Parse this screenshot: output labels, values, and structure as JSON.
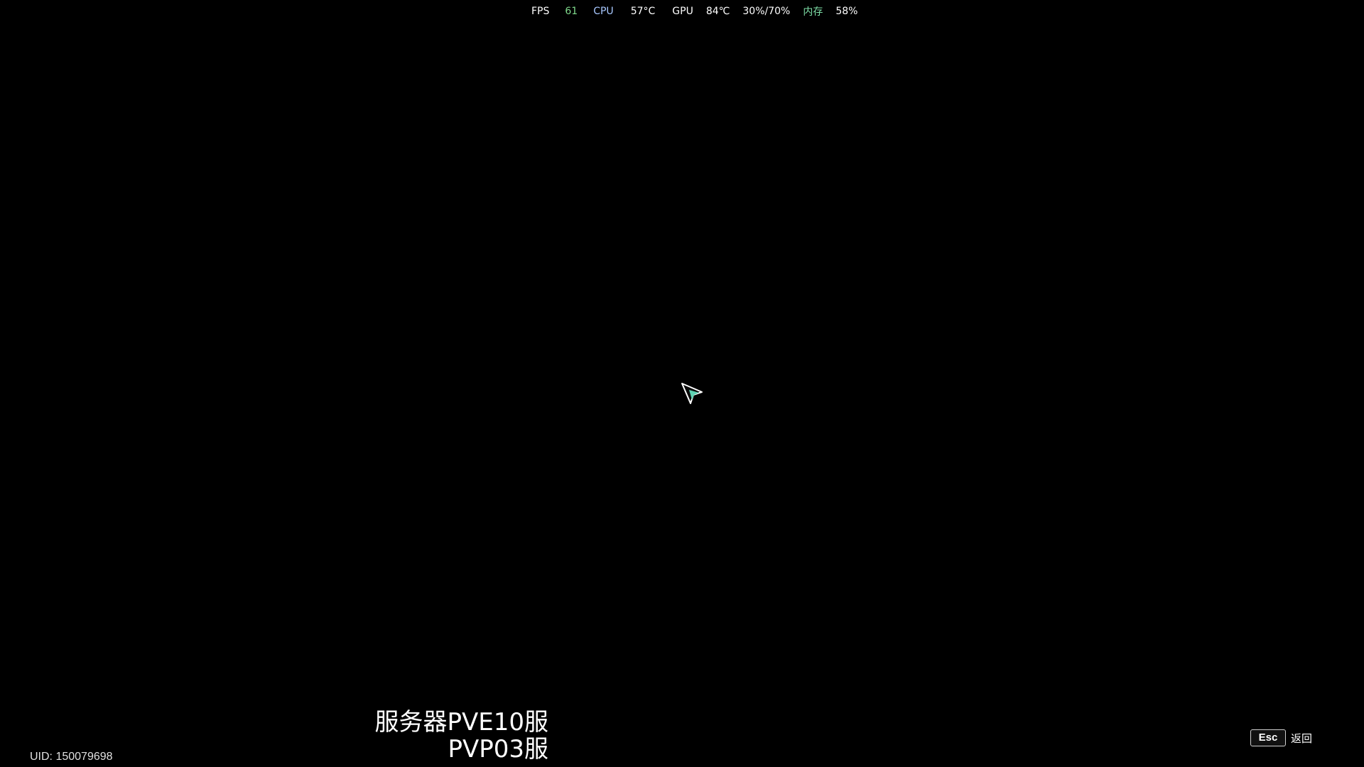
{
  "perf": {
    "fps_label": "FPS",
    "fps_value": "61",
    "cpu_label": "CPU",
    "cpu_temp": "57°C",
    "gpu_label": "GPU",
    "gpu_temp": "84℃",
    "gpu_usage": "30%/70%",
    "mem_label": "内存",
    "mem_value": "58%"
  },
  "server": {
    "line1": "服务器PVE10服",
    "line2": "PVP03服"
  },
  "uid": "UID: 150079698",
  "esc": {
    "key": "Esc",
    "label": "返回"
  },
  "colors": {
    "background": "#000000",
    "fps_value": "#7fd98b",
    "cpu_label": "#a8c8ff",
    "mem_label": "#7fe0a8",
    "cursor_fill": "#5fd3b3"
  },
  "icons": {
    "cursor": "cursor-arrow-icon"
  }
}
